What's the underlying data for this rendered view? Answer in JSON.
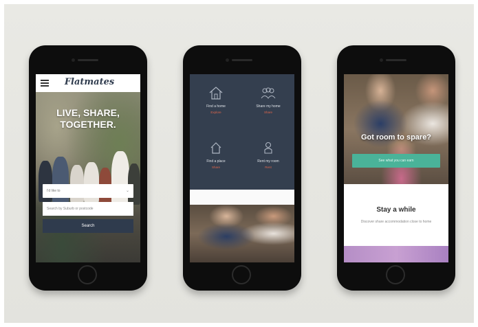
{
  "phone1": {
    "logo": "Flatmates",
    "headline_line1": "LIVE, SHARE,",
    "headline_line2": "TOGETHER.",
    "select_value": "I'd like to",
    "search_placeholder": "Search by Suburb or postcode",
    "search_button": "Search"
  },
  "phone2": {
    "cells": [
      {
        "label": "Find a home",
        "link": "Explore",
        "icon": "house-outline-icon"
      },
      {
        "label": "Share my home",
        "link": "Share",
        "icon": "people-group-icon"
      },
      {
        "label": "Find a place",
        "link": "Share",
        "icon": "house-small-icon"
      },
      {
        "label": "Rent my room",
        "link": "Rent",
        "icon": "person-icon"
      }
    ]
  },
  "phone3": {
    "question": "Got room to spare?",
    "cta": "See what you can earn",
    "section_title": "Stay a while",
    "section_text": "Discover share accommodation close to home"
  },
  "colors": {
    "navy": "#2f3b4d",
    "slate": "#343f4f",
    "teal": "#4ab399",
    "coral": "#e0664b"
  }
}
